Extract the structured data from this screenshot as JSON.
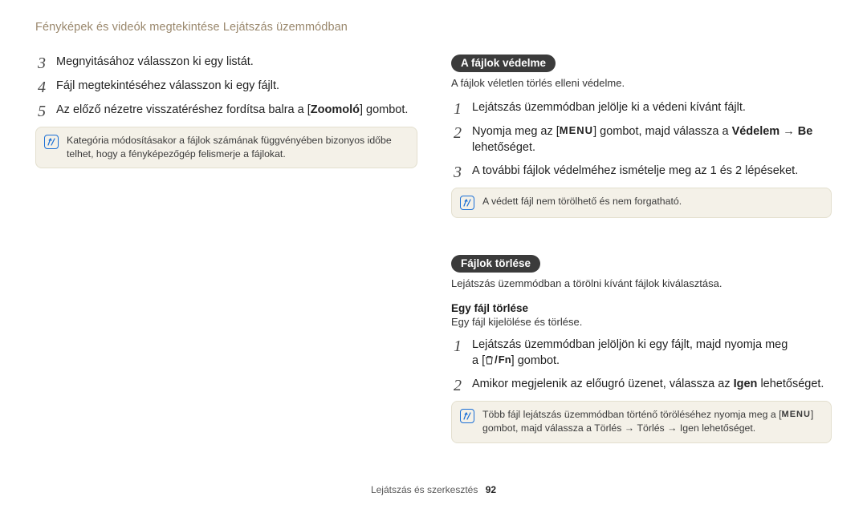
{
  "header": {
    "title": "Fényképek és videók megtekintése Lejátszás üzemmódban"
  },
  "left": {
    "steps": {
      "s3": {
        "num": "3",
        "text": "Megnyitásához válasszon ki egy listát."
      },
      "s4": {
        "num": "4",
        "text": "Fájl megtekintéséhez válasszon ki egy fájlt."
      },
      "s5": {
        "num": "5",
        "pre": "Az előző nézetre visszatéréshez fordítsa balra a [",
        "bold": "Zoomoló",
        "post": "] gombot."
      }
    },
    "note": "Kategória módosításakor a fájlok számának függvényében bizonyos időbe telhet, hogy a fényképezőgép felismerje a fájlokat."
  },
  "right": {
    "protect": {
      "pill": "A fájlok védelme",
      "desc": "A fájlok véletlen törlés elleni védelme.",
      "step1": {
        "num": "1",
        "text": "Lejátszás üzemmódban jelölje ki a védeni kívánt fájlt."
      },
      "step2": {
        "num": "2",
        "pre": "Nyomja meg az [",
        "menu": "MENU",
        "mid": "] gombot, majd válassza a ",
        "bold": "Védelem",
        "arrow": " → ",
        "bold2": "Be",
        "post": " lehetőséget."
      },
      "step3": {
        "num": "3",
        "text": "A további fájlok védelméhez ismételje meg az 1 és 2 lépéseket."
      },
      "note": "A védett fájl nem törölhető és nem forgatható."
    },
    "delete": {
      "pill": "Fájlok törlése",
      "desc": "Lejátszás üzemmódban a törölni kívánt fájlok kiválasztása.",
      "sub_heading": "Egy fájl törlése",
      "sub_text": "Egy fájl kijelölése és törlése.",
      "step1": {
        "num": "1",
        "line1": "Lejátszás üzemmódban jelöljön ki egy fájlt, majd nyomja meg",
        "line2_pre": "a [",
        "fn": "Fn",
        "line2_post": "] gombot."
      },
      "step2": {
        "num": "2",
        "pre": "Amikor megjelenik az előugró üzenet, válassza az ",
        "bold": "Igen",
        "post": " lehetőséget."
      },
      "note": {
        "pre": "Több fájl lejátszás üzemmódban történő töröléséhez nyomja meg a [",
        "menu": "MENU",
        "mid": "] gombot, majd válassza a ",
        "b1": "Törlés",
        "a1": " → ",
        "b2": "Törlés",
        "a2": " → ",
        "b3": "Igen",
        "post": " lehetőséget."
      }
    }
  },
  "footer": {
    "section": "Lejátszás és szerkesztés",
    "page": "92"
  }
}
